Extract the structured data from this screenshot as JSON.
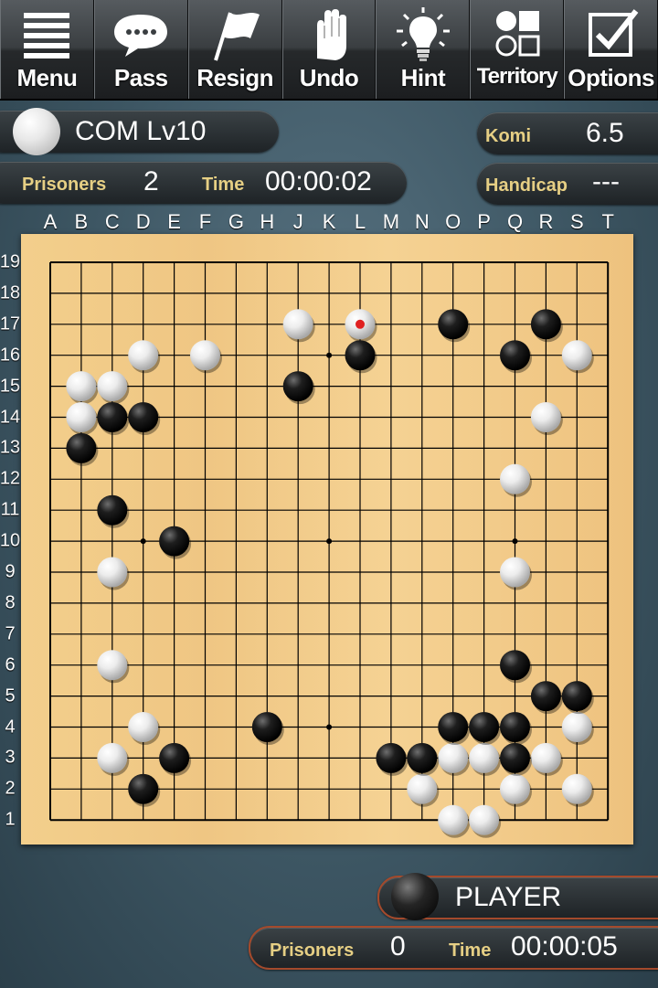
{
  "toolbar": {
    "buttons": [
      {
        "label": "Menu",
        "icon": "menu-icon"
      },
      {
        "label": "Pass",
        "icon": "speech-bubble-icon"
      },
      {
        "label": "Resign",
        "icon": "flag-icon"
      },
      {
        "label": "Undo",
        "icon": "hand-icon"
      },
      {
        "label": "Hint",
        "icon": "lightbulb-icon"
      },
      {
        "label": "Territory",
        "icon": "territory-icon"
      },
      {
        "label": "Options",
        "icon": "checkbox-icon"
      }
    ]
  },
  "opponent": {
    "name": "COM Lv10",
    "stone": "white",
    "prisoners_label": "Prisoners",
    "prisoners": "2",
    "time_label": "Time",
    "time": "00:00:02"
  },
  "game_info": {
    "komi_label": "Komi",
    "komi": "6.5",
    "handicap_label": "Handicap",
    "handicap": "---"
  },
  "player": {
    "name": "PLAYER",
    "stone": "black",
    "prisoners_label": "Prisoners",
    "prisoners": "0",
    "time_label": "Time",
    "time": "00:00:05"
  },
  "board": {
    "size": 19,
    "columns": [
      "A",
      "B",
      "C",
      "D",
      "E",
      "F",
      "G",
      "H",
      "J",
      "K",
      "L",
      "M",
      "N",
      "O",
      "P",
      "Q",
      "R",
      "S",
      "T"
    ],
    "rows": [
      "19",
      "18",
      "17",
      "16",
      "15",
      "14",
      "13",
      "12",
      "11",
      "10",
      "9",
      "8",
      "7",
      "6",
      "5",
      "4",
      "3",
      "2",
      "1"
    ],
    "last_move": "L17",
    "white_stones": [
      "J17",
      "L17",
      "D16",
      "F16",
      "S16",
      "B15",
      "C15",
      "B14",
      "R14",
      "Q12",
      "C9",
      "Q9",
      "C6",
      "D4",
      "S4",
      "C3",
      "O3",
      "P3",
      "R3",
      "N2",
      "Q2",
      "S2",
      "O1",
      "P1"
    ],
    "black_stones": [
      "O17",
      "R17",
      "L16",
      "Q16",
      "J15",
      "C14",
      "D14",
      "B13",
      "C11",
      "E10",
      "Q6",
      "R5",
      "S5",
      "H4",
      "O4",
      "P4",
      "Q4",
      "E3",
      "M3",
      "N3",
      "Q3",
      "D2"
    ],
    "colors": {
      "wood": "#f1ca88",
      "line": "#000000",
      "last_move_marker": "#e02020"
    }
  }
}
